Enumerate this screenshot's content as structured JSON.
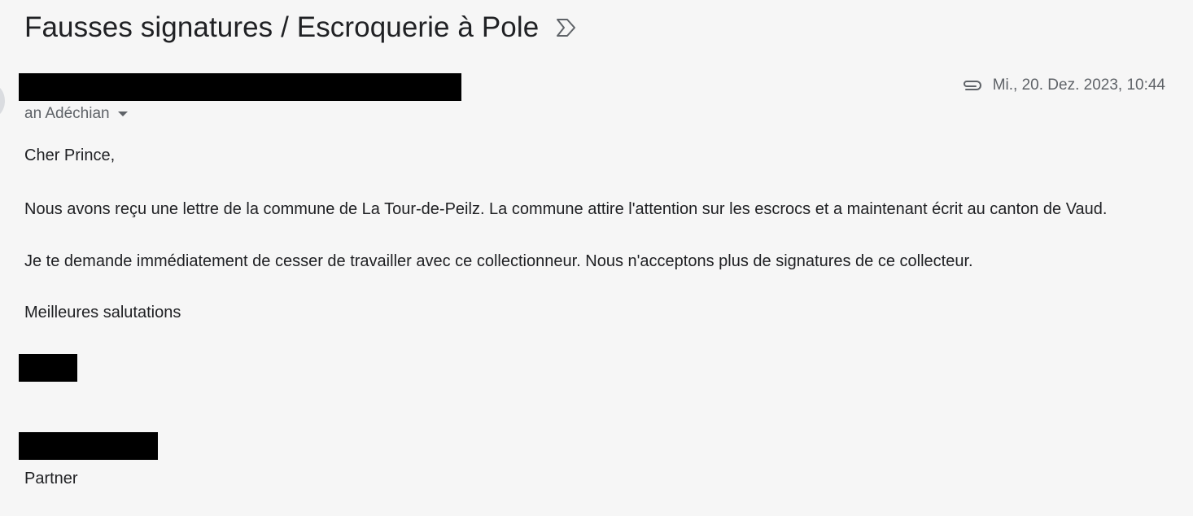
{
  "email": {
    "subject": "Fausses signatures / Escroquerie à Pole",
    "recipient_label": "an Adéchian",
    "date": "Mi., 20. Dez. 2023, 10:44",
    "body": {
      "greeting": "Cher Prince,",
      "paragraph_1": "Nous avons reçu une lettre de la commune de La Tour-de-Peilz. La commune attire l'attention sur les escrocs et a maintenant écrit au canton de Vaud.",
      "paragraph_2": "Je te demande immédiatement de cesser de travailler avec ce collectionneur. Nous n'acceptons plus de signatures de ce collecteur.",
      "closing": "Meilleures salutations",
      "role": "Partner"
    }
  },
  "icons": {
    "label": "label-outline-icon",
    "attachment": "paperclip-icon",
    "recipient_caret": "caret-down-icon"
  },
  "colors": {
    "background": "#f6f6f6",
    "text": "#202124",
    "secondary_text": "#5f6368",
    "redaction": "#000000"
  }
}
